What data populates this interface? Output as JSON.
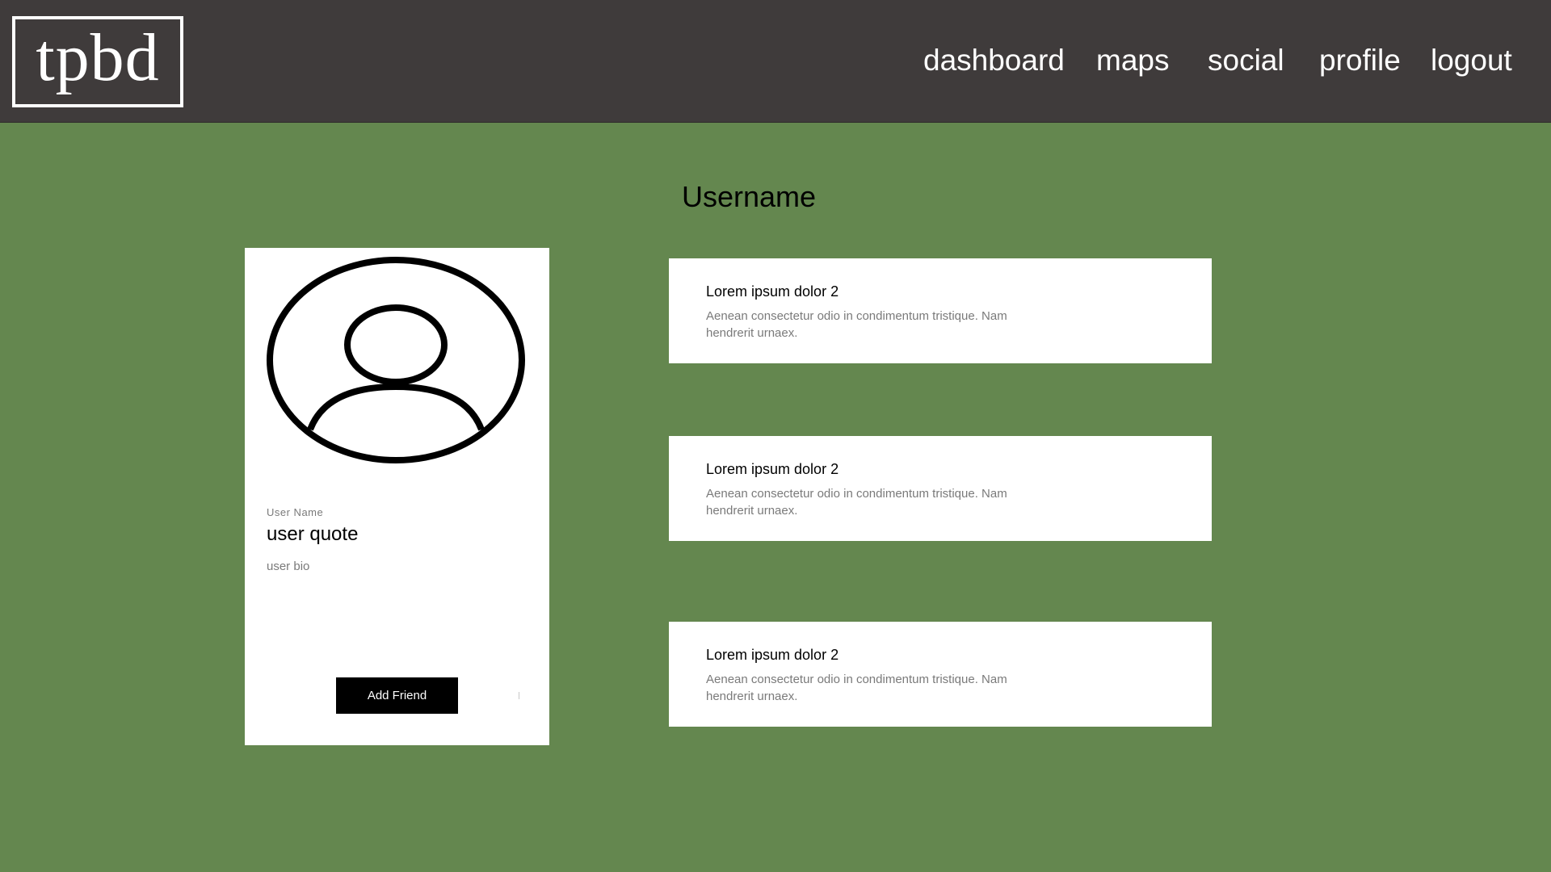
{
  "header": {
    "logo_text": "tpbd",
    "nav": [
      "dashboard",
      "maps",
      "social",
      "profile",
      "logout"
    ]
  },
  "page": {
    "title": "Username"
  },
  "profile": {
    "avatar_icon": "user-avatar-icon",
    "user_name_label": "User Name",
    "quote": "user quote",
    "bio": "user bio",
    "add_friend_label": "Add Friend"
  },
  "posts": [
    {
      "title": "Lorem ipsum dolor 2",
      "body": "Aenean consectetur odio in condimentum tristique. Nam hendrerit urnaex."
    },
    {
      "title": "Lorem ipsum dolor 2",
      "body": "Aenean consectetur odio in condimentum tristique. Nam hendrerit urnaex."
    },
    {
      "title": "Lorem ipsum dolor 2",
      "body": "Aenean consectetur odio in condimentum tristique. Nam hendrerit urnaex."
    }
  ],
  "colors": {
    "background": "#64874f",
    "header": "#3f3b3b",
    "card": "#ffffff",
    "button": "#000000"
  }
}
